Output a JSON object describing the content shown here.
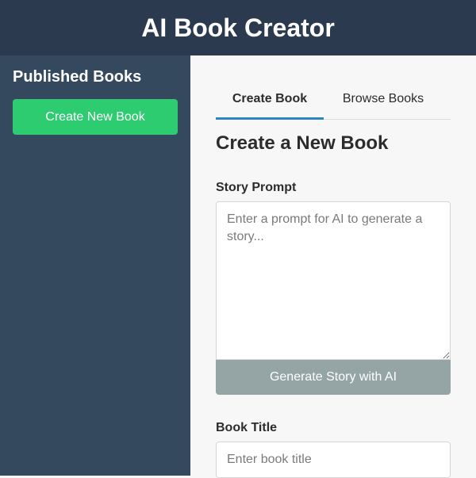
{
  "header": {
    "title": "AI Book Creator"
  },
  "sidebar": {
    "title": "Published Books",
    "create_button": "Create New Book"
  },
  "tabs": [
    {
      "label": "Create Book",
      "active": true
    },
    {
      "label": "Browse Books",
      "active": false
    }
  ],
  "form": {
    "heading": "Create a New Book",
    "prompt_label": "Story Prompt",
    "prompt_placeholder": "Enter a prompt for AI to generate a story...",
    "generate_button": "Generate Story with AI",
    "title_label": "Book Title",
    "title_placeholder": "Enter book title"
  },
  "colors": {
    "header_bg": "#2b3a4e",
    "sidebar_bg": "#34495e",
    "create_button": "#2ecc71",
    "generate_button_disabled": "#95a5a6",
    "tab_accent": "#2e86c1"
  }
}
